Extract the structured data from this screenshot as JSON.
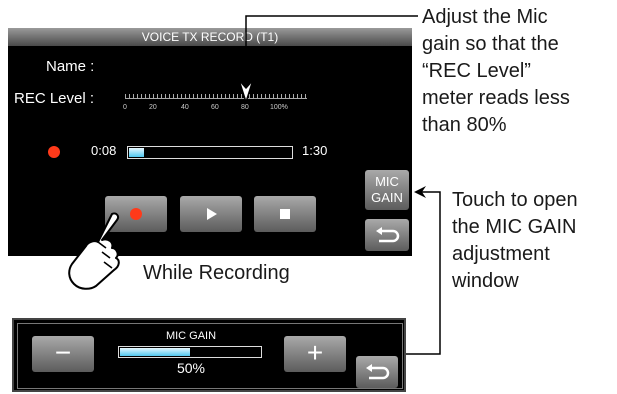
{
  "screen": {
    "title": "VOICE TX RECORD (T1)",
    "name_label": "Name :",
    "rec_level_label": "REC Level :",
    "meter_ticks": [
      "0",
      "20",
      "40",
      "60",
      "80",
      "100%"
    ],
    "elapsed": "0:08",
    "total": "1:30",
    "progress_fraction": 0.09,
    "mic_button": {
      "line1": "MIC",
      "line2": "GAIN"
    },
    "buttons": {
      "record": "record-icon",
      "play": "play-icon",
      "stop": "stop-icon",
      "back": "return-icon"
    },
    "record_color": "#ff3a1a"
  },
  "annotations": {
    "adjust": [
      "Adjust the Mic",
      "gain so that the",
      "“REC Level”",
      "meter reads less",
      "than 80%"
    ],
    "touch": [
      "Touch to open",
      "the MIC GAIN",
      "adjustment",
      "window"
    ],
    "caption": "While Recording"
  },
  "popup": {
    "title": "MIC GAIN",
    "value": "50%",
    "fraction": 0.5,
    "minus": "−",
    "plus": "+",
    "accent": "#4fc8f0"
  }
}
